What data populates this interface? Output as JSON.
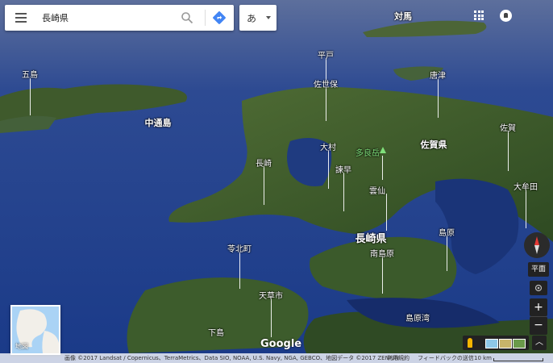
{
  "search": {
    "query": "長崎県"
  },
  "ime": {
    "label": "あ"
  },
  "map": {
    "place_labels": [
      {
        "id": "tsushima",
        "text": "対馬"
      },
      {
        "id": "goto",
        "text": "五島"
      },
      {
        "id": "hirado",
        "text": "平戸"
      },
      {
        "id": "sasebo",
        "text": "佐世保"
      },
      {
        "id": "karatsu",
        "text": "唐津"
      },
      {
        "id": "nakadori",
        "text": "中通島"
      },
      {
        "id": "saga-city",
        "text": "佐賀"
      },
      {
        "id": "omura",
        "text": "大村"
      },
      {
        "id": "tara",
        "text": "多良岳"
      },
      {
        "id": "saga-pref",
        "text": "佐賀県"
      },
      {
        "id": "nagasaki",
        "text": "長崎"
      },
      {
        "id": "isahaya",
        "text": "諫早"
      },
      {
        "id": "unzen",
        "text": "雲仙"
      },
      {
        "id": "omuta",
        "text": "大牟田"
      },
      {
        "id": "nagasaki-pref",
        "text": "長崎県"
      },
      {
        "id": "shimabara",
        "text": "島原"
      },
      {
        "id": "reihoku",
        "text": "苓北町"
      },
      {
        "id": "minamishimabara",
        "text": "南島原"
      },
      {
        "id": "amakusa",
        "text": "天草市"
      },
      {
        "id": "shimabara-bay",
        "text": "島原湾"
      },
      {
        "id": "shimo",
        "text": "下島"
      }
    ]
  },
  "minimap": {
    "label": "地図"
  },
  "controls": {
    "flat_label": "平面",
    "zoom_in": "+",
    "zoom_out": "−",
    "expand": "︿"
  },
  "branding": {
    "logo": "Google"
  },
  "footer": {
    "imagery": "画像 ©2017 Landsat / Copernicus、TerraMetrics、Data SIO, NOAA, U.S. Navy, NGA, GEBCO、地図データ ©2017 ZENRIN",
    "terms": "利用規約",
    "feedback": "フィードバックの送信",
    "scale": "10 km"
  },
  "colors": {
    "sea": "#1b3b86",
    "land": "#3a5a2a",
    "accent_direction": "#4285f4"
  }
}
